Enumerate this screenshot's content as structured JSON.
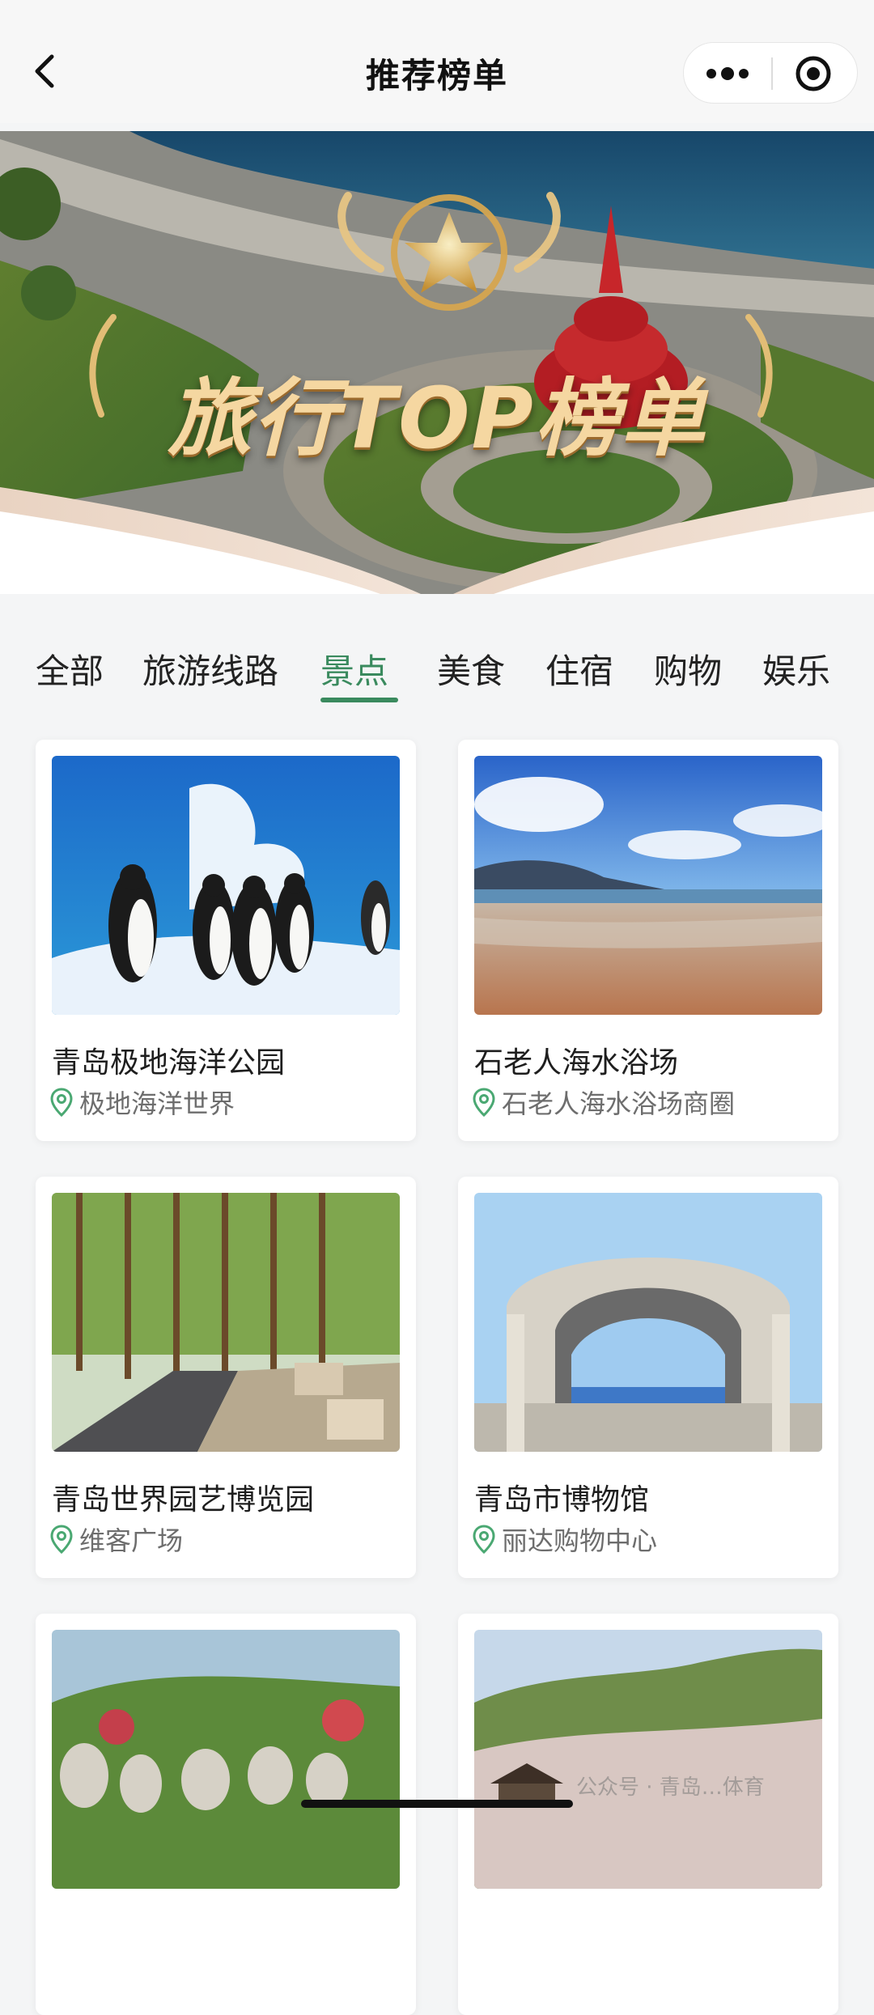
{
  "nav": {
    "title": "推荐榜单",
    "back_icon": "chevron-left-icon",
    "more_icon": "more-dots-icon",
    "target_icon": "close-target-icon"
  },
  "banner": {
    "title": "旅行TOP榜单"
  },
  "tabs": [
    {
      "label": "全部"
    },
    {
      "label": "旅游线路"
    },
    {
      "label": "景点"
    },
    {
      "label": "美食"
    },
    {
      "label": "住宿"
    },
    {
      "label": "购物"
    },
    {
      "label": "娱乐"
    }
  ],
  "active_tab": "景点",
  "cards": [
    {
      "name": "青岛极地海洋公园",
      "location": "极地海洋世界"
    },
    {
      "name": "石老人海水浴场",
      "location": "石老人海水浴场商圈"
    },
    {
      "name": "青岛世界园艺博览园",
      "location": "维客广场"
    },
    {
      "name": "青岛市博物馆",
      "location": "丽达购物中心"
    },
    {
      "name": "",
      "location": ""
    },
    {
      "name": "",
      "location": ""
    }
  ],
  "watermark": "公众号 · 青岛…体育",
  "colors": {
    "accent": "#3a8a5e",
    "pin": "#4aa872",
    "page_bg": "#f4f5f6"
  }
}
